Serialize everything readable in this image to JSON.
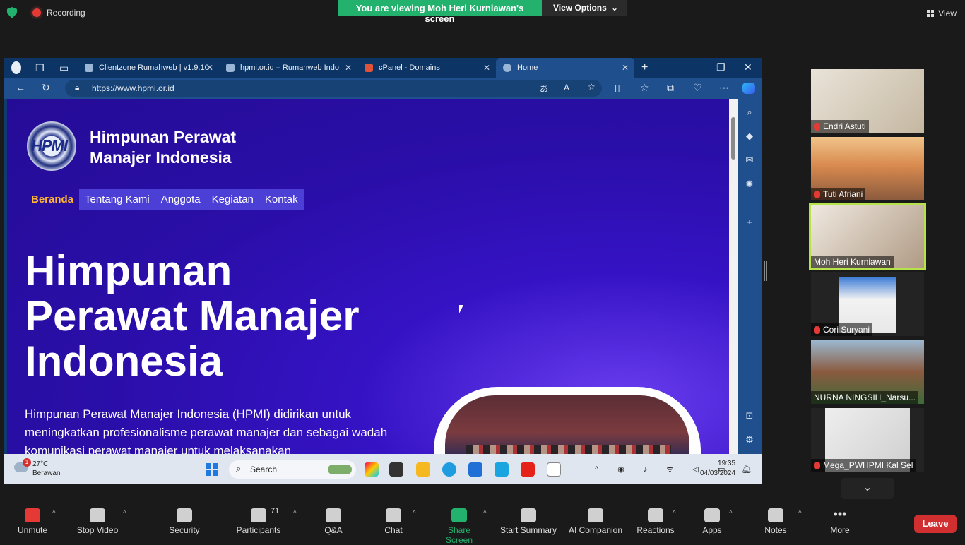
{
  "zoom": {
    "recording_label": "Recording",
    "viewing_banner": "You are viewing Moh Heri Kurniawan's screen",
    "view_options": "View Options",
    "view_label": "View",
    "participants_count": "71",
    "toolbar": [
      {
        "label": "Unmute",
        "icon": "mic-muted-icon"
      },
      {
        "label": "Stop Video",
        "icon": "video-icon"
      },
      {
        "label": "Security",
        "icon": "shield-icon"
      },
      {
        "label": "Participants",
        "icon": "participants-icon"
      },
      {
        "label": "Q&A",
        "icon": "qa-icon"
      },
      {
        "label": "Chat",
        "icon": "chat-icon"
      },
      {
        "label": "Share Screen",
        "icon": "share-screen-icon"
      },
      {
        "label": "Start Summary",
        "icon": "summary-icon"
      },
      {
        "label": "AI Companion",
        "icon": "sparkle-icon"
      },
      {
        "label": "Reactions",
        "icon": "reactions-icon"
      },
      {
        "label": "Apps",
        "icon": "apps-icon"
      },
      {
        "label": "Notes",
        "icon": "notes-icon"
      },
      {
        "label": "More",
        "icon": "more-icon"
      }
    ],
    "leave_label": "Leave",
    "participants": [
      {
        "name": "Endri Astuti",
        "muted": true
      },
      {
        "name": "Tuti Afriani",
        "muted": true
      },
      {
        "name": "Moh Heri Kurniawan",
        "muted": false
      },
      {
        "name": "Cori Suryani",
        "muted": true
      },
      {
        "name": "NURNA NINGSIH_Narsu...",
        "muted": false
      },
      {
        "name": "Mega_PWHPMI Kal Sel",
        "muted": true
      }
    ]
  },
  "browser": {
    "tabs": [
      {
        "label": "Clientzone Rumahweb | v1.9.10"
      },
      {
        "label": "hpmi.or.id – Rumahweb Indone..."
      },
      {
        "label": "cPanel - Domains"
      },
      {
        "label": "Home"
      }
    ],
    "url": "https://www.hpmi.or.id"
  },
  "site": {
    "logo_text": "HPMI",
    "org_name_line1": "Himpunan Perawat",
    "org_name_line2": "Manajer Indonesia",
    "nav": [
      "Beranda",
      "Tentang Kami",
      "Anggota",
      "Kegiatan",
      "Kontak"
    ],
    "hero_line1": "Himpunan",
    "hero_line2": "Perawat Manajer",
    "hero_line3": "Indonesia",
    "description": "Himpunan Perawat Manajer Indonesia (HPMI) didirikan untuk meningkatkan profesionalisme perawat manajer dan sebagai wadah komunikasi perawat manajer untuk melaksanakan"
  },
  "taskbar": {
    "weather_temp": "27°C",
    "weather_desc": "Berawan",
    "weather_badge": "1",
    "search_placeholder": "Search",
    "time": "19:35",
    "date": "04/03/2024"
  }
}
